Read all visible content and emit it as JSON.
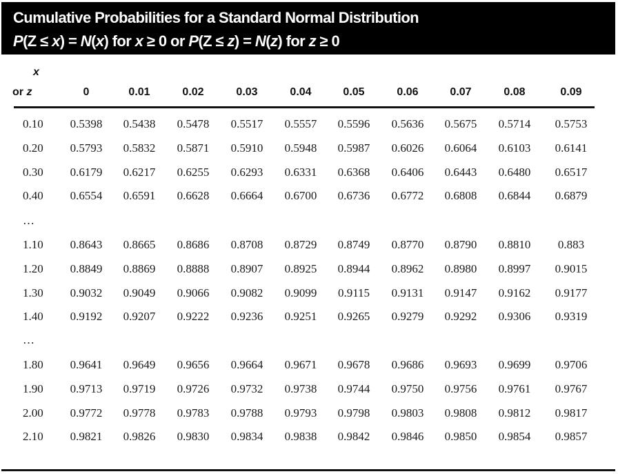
{
  "header": {
    "title": "Cumulative Probabilities for a Standard Normal Distribution",
    "subtitle_parts": [
      "P",
      "(Z ≤ ",
      "x",
      ") = ",
      "N",
      "(",
      "x",
      ") for ",
      "x",
      " ≥ 0 or ",
      "P",
      "(Z ≤ ",
      "z",
      ") = ",
      "N",
      "(",
      "z",
      ") for ",
      "z",
      " ≥ 0"
    ]
  },
  "table": {
    "row_header_top": "x",
    "row_header_bottom_prefix": "or ",
    "row_header_bottom_var": "z",
    "columns": [
      "0",
      "0.01",
      "0.02",
      "0.03",
      "0.04",
      "0.05",
      "0.06",
      "0.07",
      "0.08",
      "0.09"
    ],
    "ellipsis": "…",
    "groups": [
      {
        "rows": [
          {
            "label": "0.10",
            "values": [
              "0.5398",
              "0.5438",
              "0.5478",
              "0.5517",
              "0.5557",
              "0.5596",
              "0.5636",
              "0.5675",
              "0.5714",
              "0.5753"
            ]
          },
          {
            "label": "0.20",
            "values": [
              "0.5793",
              "0.5832",
              "0.5871",
              "0.5910",
              "0.5948",
              "0.5987",
              "0.6026",
              "0.6064",
              "0.6103",
              "0.6141"
            ]
          },
          {
            "label": "0.30",
            "values": [
              "0.6179",
              "0.6217",
              "0.6255",
              "0.6293",
              "0.6331",
              "0.6368",
              "0.6406",
              "0.6443",
              "0.6480",
              "0.6517"
            ]
          },
          {
            "label": "0.40",
            "values": [
              "0.6554",
              "0.6591",
              "0.6628",
              "0.6664",
              "0.6700",
              "0.6736",
              "0.6772",
              "0.6808",
              "0.6844",
              "0.6879"
            ]
          }
        ]
      },
      {
        "rows": [
          {
            "label": "1.10",
            "values": [
              "0.8643",
              "0.8665",
              "0.8686",
              "0.8708",
              "0.8729",
              "0.8749",
              "0.8770",
              "0.8790",
              "0.8810",
              "0.883"
            ]
          },
          {
            "label": "1.20",
            "values": [
              "0.8849",
              "0.8869",
              "0.8888",
              "0.8907",
              "0.8925",
              "0.8944",
              "0.8962",
              "0.8980",
              "0.8997",
              "0.9015"
            ]
          },
          {
            "label": "1.30",
            "values": [
              "0.9032",
              "0.9049",
              "0.9066",
              "0.9082",
              "0.9099",
              "0.9115",
              "0.9131",
              "0.9147",
              "0.9162",
              "0.9177"
            ]
          },
          {
            "label": "1.40",
            "values": [
              "0.9192",
              "0.9207",
              "0.9222",
              "0.9236",
              "0.9251",
              "0.9265",
              "0.9279",
              "0.9292",
              "0.9306",
              "0.9319"
            ]
          }
        ]
      },
      {
        "rows": [
          {
            "label": "1.80",
            "values": [
              "0.9641",
              "0.9649",
              "0.9656",
              "0.9664",
              "0.9671",
              "0.9678",
              "0.9686",
              "0.9693",
              "0.9699",
              "0.9706"
            ]
          },
          {
            "label": "1.90",
            "values": [
              "0.9713",
              "0.9719",
              "0.9726",
              "0.9732",
              "0.9738",
              "0.9744",
              "0.9750",
              "0.9756",
              "0.9761",
              "0.9767"
            ]
          },
          {
            "label": "2.00",
            "values": [
              "0.9772",
              "0.9778",
              "0.9783",
              "0.9788",
              "0.9793",
              "0.9798",
              "0.9803",
              "0.9808",
              "0.9812",
              "0.9817"
            ]
          },
          {
            "label": "2.10",
            "values": [
              "0.9821",
              "0.9826",
              "0.9830",
              "0.9834",
              "0.9838",
              "0.9842",
              "0.9846",
              "0.9850",
              "0.9854",
              "0.9857"
            ]
          }
        ]
      }
    ]
  }
}
